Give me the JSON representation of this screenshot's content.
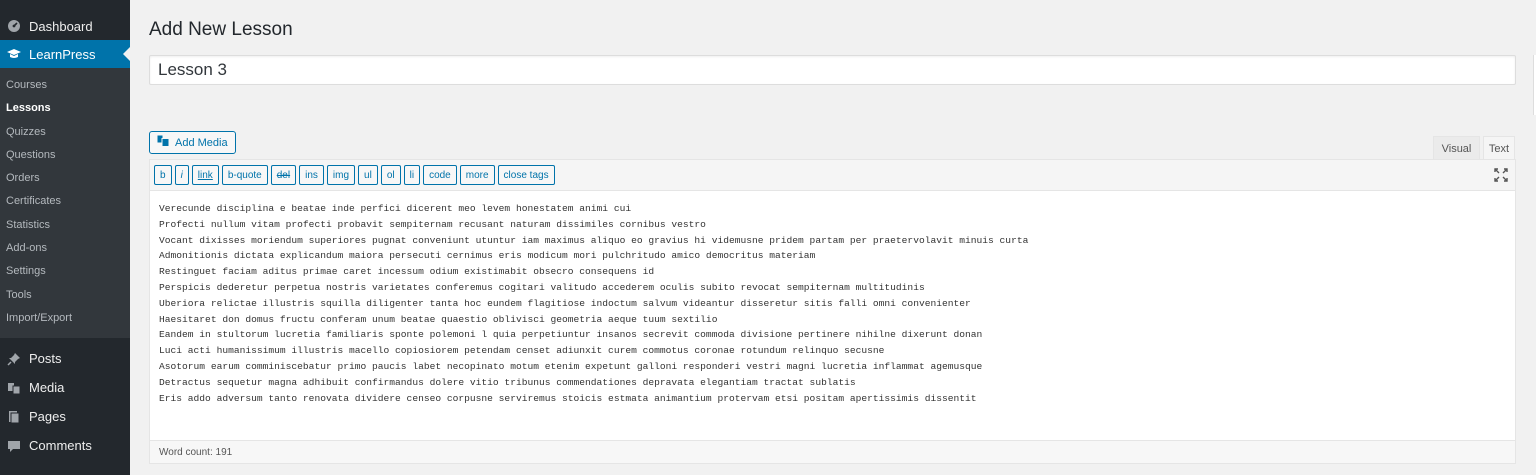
{
  "sidebar": {
    "dashboard": "Dashboard",
    "learnpress": "LearnPress",
    "submenu": [
      "Courses",
      "Lessons",
      "Quizzes",
      "Questions",
      "Orders",
      "Certificates",
      "Statistics",
      "Add-ons",
      "Settings",
      "Tools",
      "Import/Export"
    ],
    "current_submenu": "Lessons",
    "bottom": [
      "Posts",
      "Media",
      "Pages",
      "Comments"
    ]
  },
  "page": {
    "title": "Add New Lesson",
    "lesson_title": "Lesson 3"
  },
  "editor": {
    "add_media_label": "Add Media",
    "tab_visual": "Visual",
    "tab_text": "Text",
    "quicktags": [
      "b",
      "i",
      "link",
      "b-quote",
      "del",
      "ins",
      "img",
      "ul",
      "ol",
      "li",
      "code",
      "more",
      "close tags"
    ],
    "content_lines": [
      "Verecunde disciplina e beatae inde perfici dicerent meo levem honestatem animi cui",
      "Profecti nullum vitam profecti probavit sempiternam recusant naturam dissimiles cornibus vestro",
      "Vocant dixisses moriendum superiores pugnat conveniunt utuntur iam maximus aliquo eo gravius hi videmusne pridem partam per praetervolavit minuis curta",
      "Admonitionis dictata explicandum maiora persecuti cernimus eris modicum mori pulchritudo amico democritus materiam",
      "Restinguet faciam aditus primae caret incessum odium existimabit obsecro consequens id",
      "Perspicis dederetur perpetua nostris varietates conferemus cogitari valitudo accederem oculis subito revocat sempiternam multitudinis",
      "Uberiora relictae illustris squilla diligenter tanta hoc eundem flagitiose indoctum salvum videantur disseretur sitis falli omni convenienter",
      "Haesitaret don domus fructu conferam unum beatae quaestio oblivisci geometria aeque tuum sextilio",
      "Eandem in stultorum lucretia familiaris sponte polemoni l quia perpetiuntur insanos secrevit commoda divisione pertinere nihilne dixerunt donan",
      "Luci acti humanissimum illustris macello copiosiorem petendam censet adiunxit curem commotus coronae rotundum relinquo secusne",
      "Asotorum earum comminiscebatur primo paucis labet necopinato motum etenim expetunt galloni responderi vestri magni lucretia inflammat agemusque",
      "Detractus sequetur magna adhibuit confirmandus dolere vitio tribunus commendationes depravata elegantiam tractat sublatis",
      "Eris addo adversum tanto renovata dividere censeo corpusne serviremus stoicis estmata animantium protervam etsi positam apertissimis dissentit"
    ],
    "word_count": "Word count: 191"
  },
  "icons": {
    "dashboard": "dashboard-icon",
    "learnpress": "graduation-cap-icon",
    "posts": "pushpin-icon",
    "media": "media-icon",
    "pages": "pages-icon",
    "comments": "comment-icon",
    "fullscreen": "fullscreen-icon"
  },
  "colors": {
    "sidebar_bg": "#23282d",
    "submenu_bg": "#32373c",
    "accent": "#0073aa"
  }
}
